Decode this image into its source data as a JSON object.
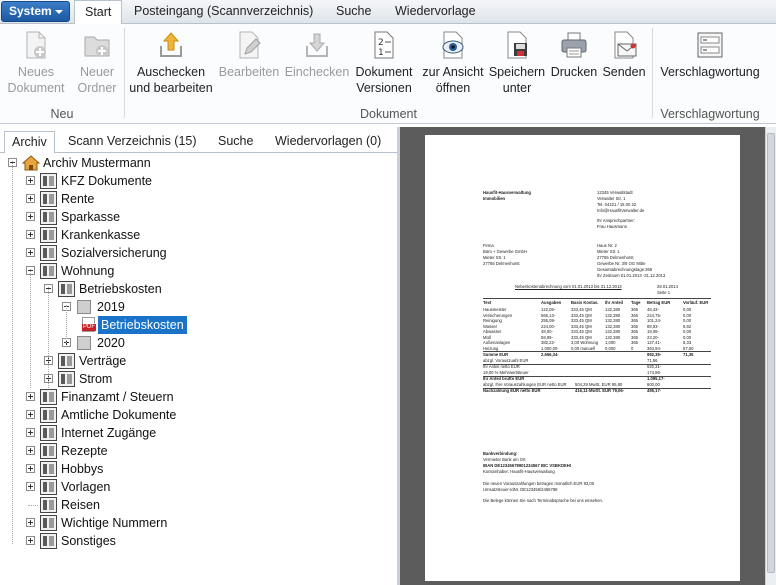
{
  "menu": {
    "system_label": "System",
    "tabs": [
      {
        "label": "Start",
        "active": true
      },
      {
        "label": "Posteingang (Scannverzeichnis)",
        "active": false
      },
      {
        "label": "Suche",
        "active": false
      },
      {
        "label": "Wiedervorlage",
        "active": false
      }
    ]
  },
  "ribbon": {
    "groups": [
      {
        "label": "Neu"
      },
      {
        "label": "Dokument"
      },
      {
        "label": "Verschlagwortung"
      }
    ],
    "buttons": [
      {
        "label1": "Neues",
        "label2": "Dokument",
        "icon": "new-document-icon",
        "enabled": false
      },
      {
        "label1": "Neuer",
        "label2": "Ordner",
        "icon": "new-folder-icon",
        "enabled": false
      },
      {
        "label1": "Auschecken",
        "label2": "und bearbeiten",
        "icon": "checkout-icon",
        "enabled": true
      },
      {
        "label1": "Bearbeiten",
        "label2": "",
        "icon": "edit-icon",
        "enabled": false
      },
      {
        "label1": "Einchecken",
        "label2": "",
        "icon": "checkin-icon",
        "enabled": false
      },
      {
        "label1": "Dokument",
        "label2": "Versionen",
        "icon": "versions-icon",
        "enabled": true
      },
      {
        "label1": "zur Ansicht",
        "label2": "öffnen",
        "icon": "view-icon",
        "enabled": true
      },
      {
        "label1": "Speichern",
        "label2": "unter",
        "icon": "save-as-icon",
        "enabled": true
      },
      {
        "label1": "Drucken",
        "label2": "",
        "icon": "print-icon",
        "enabled": true
      },
      {
        "label1": "Senden",
        "label2": "",
        "icon": "send-icon",
        "enabled": true
      },
      {
        "label1": "Verschlagwortung",
        "label2": "",
        "icon": "tagging-icon",
        "enabled": true
      }
    ]
  },
  "left_tabs": [
    {
      "label": "Archiv",
      "active": true
    },
    {
      "label": "Scann Verzeichnis (15)",
      "active": false
    },
    {
      "label": "Suche",
      "active": false
    },
    {
      "label": "Wiedervorlagen (0)",
      "active": false
    }
  ],
  "tree": [
    {
      "label": "Archiv Mustermann",
      "level": 0,
      "icon": "home-icon",
      "expander": "minus"
    },
    {
      "label": "KFZ Dokumente",
      "level": 1,
      "icon": "binder-icon",
      "expander": "plus"
    },
    {
      "label": "Rente",
      "level": 1,
      "icon": "binder-icon",
      "expander": "plus"
    },
    {
      "label": "Sparkasse",
      "level": 1,
      "icon": "binder-icon",
      "expander": "plus"
    },
    {
      "label": "Krankenkasse",
      "level": 1,
      "icon": "binder-icon",
      "expander": "plus"
    },
    {
      "label": "Sozialversicherung",
      "level": 1,
      "icon": "binder-icon",
      "expander": "plus"
    },
    {
      "label": "Wohnung",
      "level": 1,
      "icon": "binder-icon",
      "expander": "minus"
    },
    {
      "label": "Betriebskosten",
      "level": 2,
      "icon": "binder-icon",
      "expander": "minus"
    },
    {
      "label": "2019",
      "level": 3,
      "icon": "folder-icon",
      "expander": "minus"
    },
    {
      "label": "Betriebskosten",
      "level": 4,
      "icon": "pdf-icon",
      "expander": "none",
      "selected": true
    },
    {
      "label": "2020",
      "level": 3,
      "icon": "folder-icon",
      "expander": "plus"
    },
    {
      "label": "Verträge",
      "level": 2,
      "icon": "binder-icon",
      "expander": "plus"
    },
    {
      "label": "Strom",
      "level": 2,
      "icon": "binder-icon",
      "expander": "plus"
    },
    {
      "label": "Finanzamt / Steuern",
      "level": 1,
      "icon": "binder-icon",
      "expander": "plus"
    },
    {
      "label": "Amtliche Dokumente",
      "level": 1,
      "icon": "binder-icon",
      "expander": "plus"
    },
    {
      "label": "Internet Zugänge",
      "level": 1,
      "icon": "binder-icon",
      "expander": "plus"
    },
    {
      "label": "Rezepte",
      "level": 1,
      "icon": "binder-icon",
      "expander": "plus"
    },
    {
      "label": "Hobbys",
      "level": 1,
      "icon": "binder-icon",
      "expander": "plus"
    },
    {
      "label": "Vorlagen",
      "level": 1,
      "icon": "binder-icon",
      "expander": "plus"
    },
    {
      "label": "Reisen",
      "level": 1,
      "icon": "binder-icon",
      "expander": "none"
    },
    {
      "label": "Wichtige Nummern",
      "level": 1,
      "icon": "binder-icon",
      "expander": "plus"
    },
    {
      "label": "Sonstiges",
      "level": 1,
      "icon": "binder-icon",
      "expander": "plus"
    }
  ],
  "preview": {
    "sender_1": "Hausfit-Hausverwaltung",
    "sender_2": "Immobilien",
    "sender_addr_1": "12345 Verwaltstadt",
    "sender_addr_2": "Verwalter Str. 1",
    "sender_addr_3": "Tel. 04221 / 15 00 22",
    "sender_addr_4": "Info@HausfitVerwalter.de",
    "contact_1": "Ihr Ansprechpartner:",
    "contact_2": "Frau Hausmann",
    "firm_1": "Firma",
    "firm_2": "Büro + Gewerbe GmbH",
    "firm_3": "Mieter Str. 1",
    "firm_4": "27765 Delmenhorst",
    "house_1": "Haus Nr. 2",
    "house_2": "Mieter Str. 1",
    "house_3": "27765 Delmenhorst",
    "house_4": "Gewerbe Nr. 3/8 OG Mitte",
    "house_5": "Gesamtabrechnungstage:365",
    "house_6": "Ihr Zeitraum 01.01.2013 -31.12.2013",
    "title": "Nebenkostenabrechnung vom 01.01.2013 bis 31.12.2013",
    "date": "28.01.2014",
    "page": "Seite 1",
    "table_header": [
      "Text",
      "Ausgaben",
      "Basis Kostas.",
      "Ihr Anteil",
      "Tage",
      "Betrag EUR",
      "Vorläuf. EUR"
    ],
    "rows": [
      [
        "Hausmeister",
        "122,06-",
        "333,45 QM",
        "132,380",
        "365",
        "48,43-",
        "0,00"
      ],
      [
        "Versicherungen",
        "566,13-",
        "333,45 QM",
        "132,380",
        "365",
        "224,75-",
        "0,00"
      ],
      [
        "Reinigung",
        "255,08-",
        "333,45 QM",
        "132,380",
        "365",
        "101,24-",
        "0,00"
      ],
      [
        "Wasser",
        "224,00-",
        "333,45 QM",
        "132,380",
        "365",
        "88,93-",
        "8,82"
      ],
      [
        "Abwasser",
        "48,00-",
        "333,45 QM",
        "132,380",
        "365",
        "19,06-",
        "0,00"
      ],
      [
        "Müll",
        "58,99-",
        "333,45 QM",
        "132,380",
        "365",
        "23,20-",
        "0,00"
      ],
      [
        "Außenanlagen",
        "382,22-",
        "3,00 Wohnung",
        "1,000",
        "365",
        "127,41-",
        "8,33"
      ],
      [
        "Heizung",
        "1.000,00-",
        "0,00 manuell",
        "0,000",
        "0",
        "363,94-",
        "57,50"
      ]
    ],
    "summary": [
      [
        "Summe EUR",
        "2.656,34-",
        "992,35-",
        "71,35"
      ],
      [
        "abzgl. Vorauszuahl EUR",
        "",
        "71,86",
        ""
      ],
      [
        "Ihr Anteil netto EUR",
        "",
        "920,31-",
        ""
      ],
      [
        "19,00 % Mehrwertsteuer",
        "",
        "174,86-",
        ""
      ],
      [
        "Ihr Anteil brutto EUR",
        "",
        "1.095,17-",
        ""
      ],
      [
        "abzgl. Ihre Vorauszahlungen EUR netto EUR",
        "504,29 MwSt. EUR 95,80",
        "600,00",
        ""
      ],
      [
        "Nachzahlung EUR netto EUR",
        "416,11-MwSt. EUR 79,06-",
        "495,17-",
        ""
      ]
    ],
    "bank_1": "Bankverbindung:",
    "bank_2": "Vermieter Bank am Ort",
    "bank_3": "IBAN DE12345678901234567 BIC VSBKDEHI",
    "bank_4": "Kontoinhaber: Hausfit-Hausverwaltung",
    "note_1": "Die neuen Vorauszahlungen betragen monatlich EUR 83,00",
    "note_2": "Umsatzsteuer-IdNr. DE123456/2456788",
    "note_3": "Die Belege können Sie nach Terminabsprache bei uns einsehen."
  }
}
